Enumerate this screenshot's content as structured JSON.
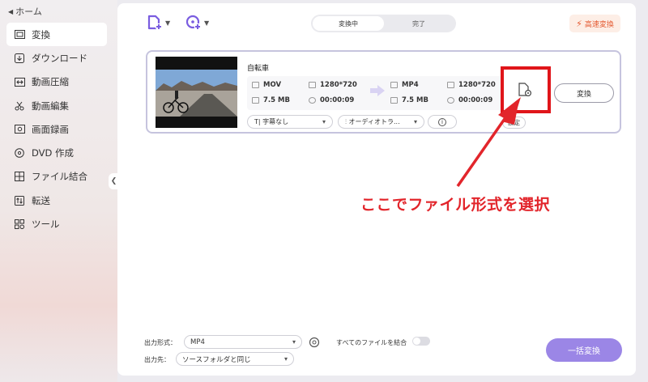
{
  "sidebar": {
    "home_label": "ホーム",
    "items": [
      {
        "label": "変換",
        "icon": "convert-icon",
        "active": true
      },
      {
        "label": "ダウンロード",
        "icon": "download-icon"
      },
      {
        "label": "動画圧縮",
        "icon": "compress-icon"
      },
      {
        "label": "動画編集",
        "icon": "scissors-icon"
      },
      {
        "label": "画面録画",
        "icon": "record-icon"
      },
      {
        "label": "DVD 作成",
        "icon": "dvd-icon"
      },
      {
        "label": "ファイル結合",
        "icon": "merge-icon"
      },
      {
        "label": "転送",
        "icon": "transfer-icon"
      },
      {
        "label": "ツール",
        "icon": "tools-icon"
      }
    ]
  },
  "header": {
    "tabs": [
      "変換中",
      "完了"
    ],
    "fast_convert": "高速変換"
  },
  "file": {
    "name": "自転車",
    "source": {
      "format": "MOV",
      "resolution": "1280*720",
      "size": "7.5 MB",
      "duration": "00:00:09"
    },
    "target": {
      "format": "MP4",
      "resolution": "1280*720",
      "size": "7.5 MB",
      "duration": "00:00:09"
    },
    "subtitle": "字幕なし",
    "audio": "オーディオトラ...",
    "settings_label": "設定",
    "convert_label": "変換"
  },
  "annotation": "ここでファイル形式を選択",
  "bottom": {
    "output_format_label": "出力形式：",
    "output_format_value": "MP4",
    "merge_label": "すべてのファイルを結合",
    "output_dest_label": "出力先：",
    "output_dest_value": "ソースフォルダと同じ",
    "batch_convert": "一括変換"
  },
  "colors": {
    "accent": "#9b86e6",
    "highlight": "#e0151a",
    "fast": "#e4572e"
  }
}
